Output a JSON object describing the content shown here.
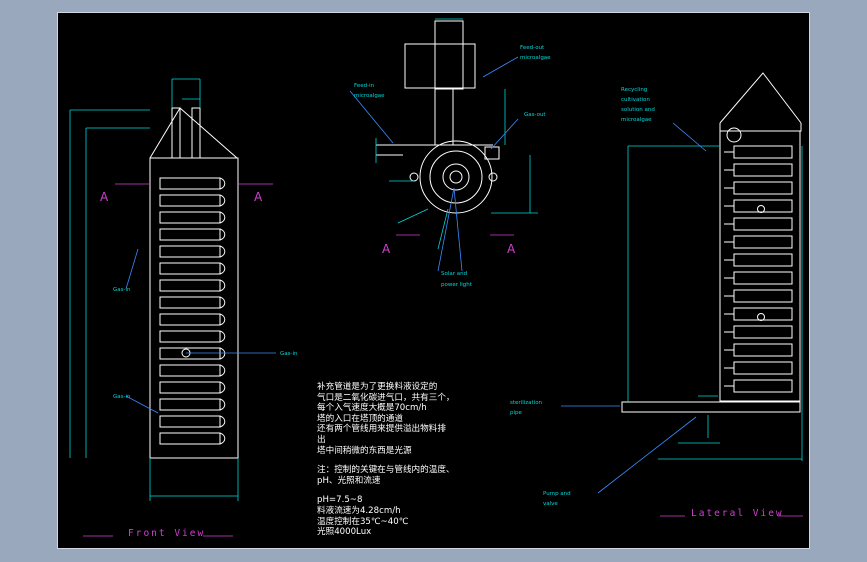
{
  "views": {
    "front_title": "Front View",
    "lateral_title": "Lateral View",
    "section_marker": "A"
  },
  "callouts": {
    "feed_in_microalgae": [
      "Feed-in",
      "microalgae"
    ],
    "feed_out_microalgae": [
      "Feed-out",
      "microalgae"
    ],
    "gas_out": "Gas-out",
    "solar_and_power_light": [
      "Solar and",
      "power light"
    ],
    "gas_in_1": "Gas-in",
    "gas_in_2": "Gas-in",
    "gas_in_3": "Gas-in",
    "recycling": [
      "Recycling",
      "cultivation",
      "solution and",
      "microalgae"
    ],
    "sterilization_pipe": [
      "sterilization",
      "pipe"
    ],
    "pump_and_valve": [
      "Pump and",
      "valve"
    ]
  },
  "notes": {
    "lines_a": [
      "补充管道是为了更换料液设定的",
      "气口是二氧化碳进气口，共有三个，",
      "每个入气速度大概是70cm/h",
      "塔的入口在塔顶的通道",
      "还有两个管线用来提供溢出物料排",
      "出",
      "塔中间稍微的东西是光源"
    ],
    "lines_b": [
      "注：控制的关键在与管线内的温度、",
      "pH、光照和流速"
    ],
    "lines_c": [
      "pH=7.5~8",
      "料液流速为4.28cm/h",
      "温度控制在35℃~40℃",
      "光照4000Lux"
    ]
  },
  "colors": {
    "background": "#000000",
    "outline": "#ffffff",
    "dimension": "#00d8d8",
    "marker": "#d040d0",
    "leader": "#3a8cff",
    "frame": "#9aa8bd"
  }
}
